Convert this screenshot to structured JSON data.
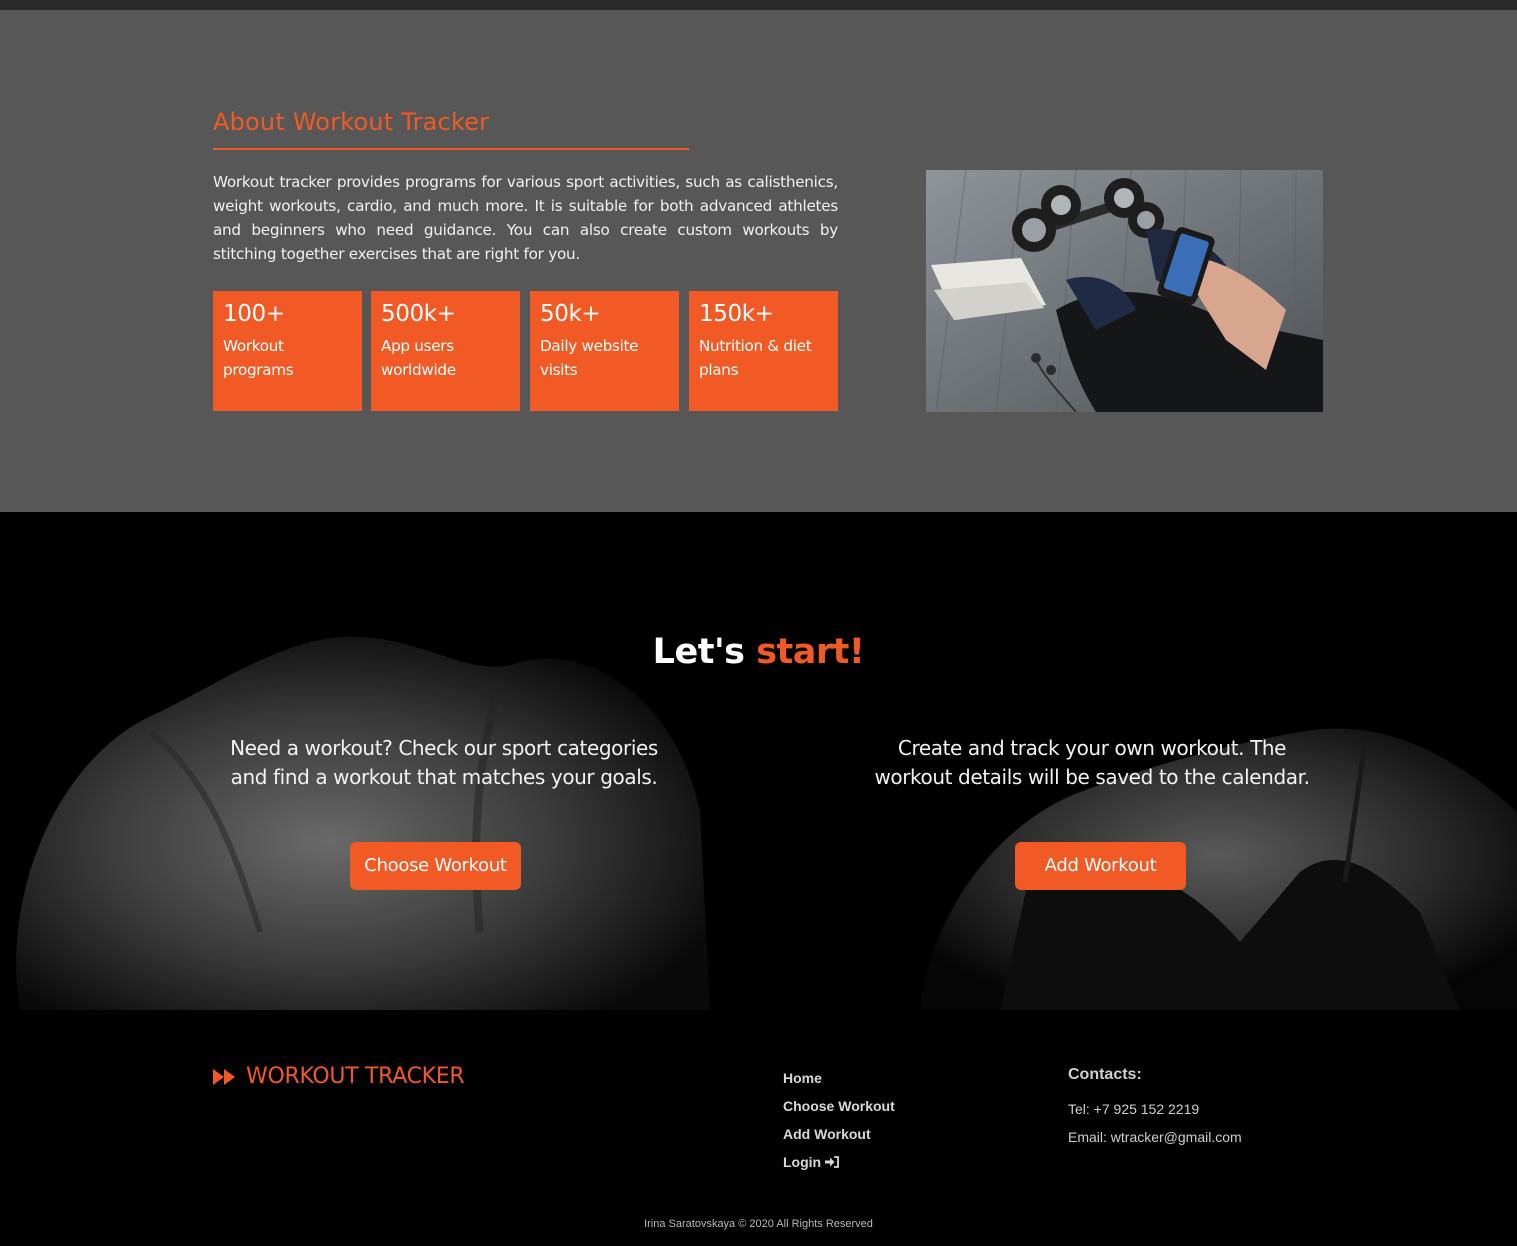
{
  "about": {
    "title": "About Workout Tracker",
    "text": "Workout tracker provides programs for various sport activities, such as calisthenics, weight workouts, cardio, and much more. It is suitable for both advanced athletes and beginners who need guidance. You can also create custom workouts by stitching together exercises that are right for you.",
    "stats": [
      {
        "value": "100+",
        "label": "Workout programs"
      },
      {
        "value": "500k+",
        "label": "App users worldwide"
      },
      {
        "value": "50k+",
        "label": "Daily website visits"
      },
      {
        "value": "150k+",
        "label": "Nutrition & diet plans"
      }
    ],
    "image_icon": "dumbbells-phone-photo"
  },
  "start": {
    "title_part1": "Let's ",
    "title_accent": "start!",
    "left_text": "Need a workout? Check our sport categories and find a workout that matches your goals.",
    "left_button": "Choose Workout",
    "right_text": "Create and track your own workout. The workout details will be saved to the calendar.",
    "right_button": "Add Workout"
  },
  "footer": {
    "brand": "WORKOUT TRACKER",
    "brand_icon": "fast-forward-icon",
    "nav": [
      "Home",
      "Choose Workout",
      "Add Workout",
      "Login"
    ],
    "login_icon": "sign-in-icon",
    "contacts_title": "Contacts:",
    "tel": "Tel: +7 925 152 2219",
    "email": "Email: wtracker@gmail.com",
    "copyright": "Irina Saratovskaya © 2020 All Rights Reserved"
  },
  "colors": {
    "accent": "#f15a24",
    "about_bg": "#575757",
    "dark_bg": "#000000"
  }
}
